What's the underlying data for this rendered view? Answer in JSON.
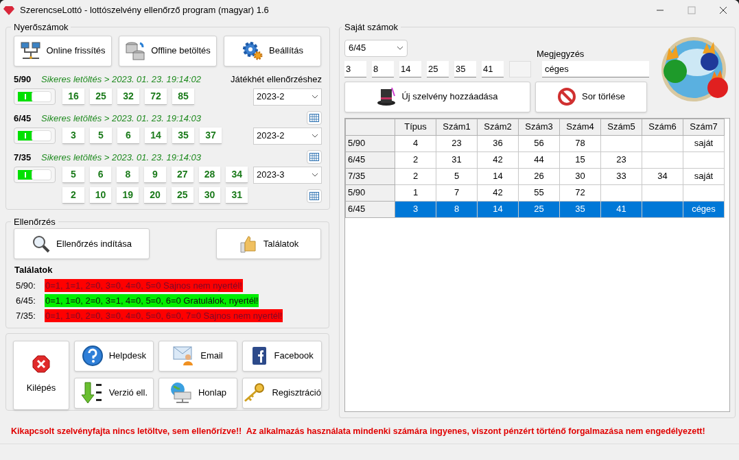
{
  "window": {
    "title": "SzerencseLottó - lottószelvény ellenőrző program (magyar) 1.6"
  },
  "winning": {
    "legend": "Nyerőszámok",
    "buttons": [
      {
        "label": "Online frissítés",
        "kind": "network"
      },
      {
        "label": "Offline betöltés",
        "kind": "database"
      },
      {
        "label": "Beállítás",
        "kind": "gear"
      }
    ],
    "week_label": "Játékhét ellenőrzéshez",
    "games": [
      {
        "name": "5/90",
        "status": "Sikeres letöltés > 2023. 01. 23. 19:14:02",
        "enabled": true,
        "rows": [
          [
            "16",
            "25",
            "32",
            "72",
            "85"
          ]
        ],
        "week": "2023-2"
      },
      {
        "name": "6/45",
        "status": "Sikeres letöltés > 2023. 01. 23. 19:14:03",
        "enabled": true,
        "rows": [
          [
            "3",
            "5",
            "6",
            "14",
            "35",
            "37"
          ]
        ],
        "week": "2023-2"
      },
      {
        "name": "7/35",
        "status": "Sikeres letöltés > 2023. 01. 23. 19:14:03",
        "enabled": true,
        "rows": [
          [
            "5",
            "6",
            "8",
            "9",
            "27",
            "28",
            "34"
          ],
          [
            "2",
            "10",
            "19",
            "20",
            "25",
            "30",
            "31"
          ]
        ],
        "week": "2023-3"
      }
    ]
  },
  "check": {
    "legend": "Ellenőrzés",
    "start_button": "Ellenőrzés indítása",
    "results_button": "Találatok",
    "results_title": "Találatok",
    "results": [
      {
        "game": "5/90:",
        "text": "0=1, 1=1, 2=0, 3=0, 4=0, 5=0 Sajnos nem nyertél!",
        "won": false
      },
      {
        "game": "6/45:",
        "text": "0=1, 1=0, 2=0, 3=1, 4=0, 5=0, 6=0 Gratulálok, nyertél!",
        "won": true
      },
      {
        "game": "7/35:",
        "text": "0=1, 1=0, 2=0, 3=0, 4=0, 5=0, 6=0, 7=0 Sajnos nem nyertél!",
        "won": false
      }
    ]
  },
  "actions": {
    "exit": "Kilépés",
    "buttons": [
      {
        "label": "Helpdesk",
        "kind": "help"
      },
      {
        "label": "Email",
        "kind": "email"
      },
      {
        "label": "Facebook",
        "kind": "facebook"
      },
      {
        "label": "Verzió ell.",
        "kind": "version"
      },
      {
        "label": "Honlap",
        "kind": "web"
      },
      {
        "label": "Regisztráció",
        "kind": "key"
      }
    ]
  },
  "own": {
    "legend": "Saját számok",
    "game_select": "6/45",
    "numbers": [
      "3",
      "8",
      "14",
      "25",
      "35",
      "41"
    ],
    "note_label": "Megjegyzés",
    "note": "céges",
    "add_button": "Új szelvény hozzáadása",
    "delete_button": "Sor törlése"
  },
  "table": {
    "columns": [
      "Típus",
      "Szám1",
      "Szám2",
      "Szám3",
      "Szám4",
      "Szám5",
      "Szám6",
      "Szám7"
    ],
    "rows": [
      {
        "game": "5/90",
        "cells": [
          "4",
          "23",
          "36",
          "56",
          "78",
          "",
          "",
          "saját"
        ],
        "selected": false
      },
      {
        "game": "6/45",
        "cells": [
          "2",
          "31",
          "42",
          "44",
          "15",
          "23",
          "",
          ""
        ],
        "selected": false
      },
      {
        "game": "7/35",
        "cells": [
          "2",
          "5",
          "14",
          "26",
          "30",
          "33",
          "34",
          "saját"
        ],
        "selected": false
      },
      {
        "game": "5/90",
        "cells": [
          "1",
          "7",
          "42",
          "55",
          "72",
          "",
          "",
          ""
        ],
        "selected": false
      },
      {
        "game": "6/45",
        "cells": [
          "3",
          "8",
          "14",
          "25",
          "35",
          "41",
          "",
          "céges"
        ],
        "selected": true
      }
    ]
  },
  "footer": "Kikapcsolt szelvényfajta nincs letöltve, sem ellenőrízve!!  Az alkalmazás használata mindenki számára ingyenes, viszont pénzért történő forgalmazása nem engedélyezett!"
}
